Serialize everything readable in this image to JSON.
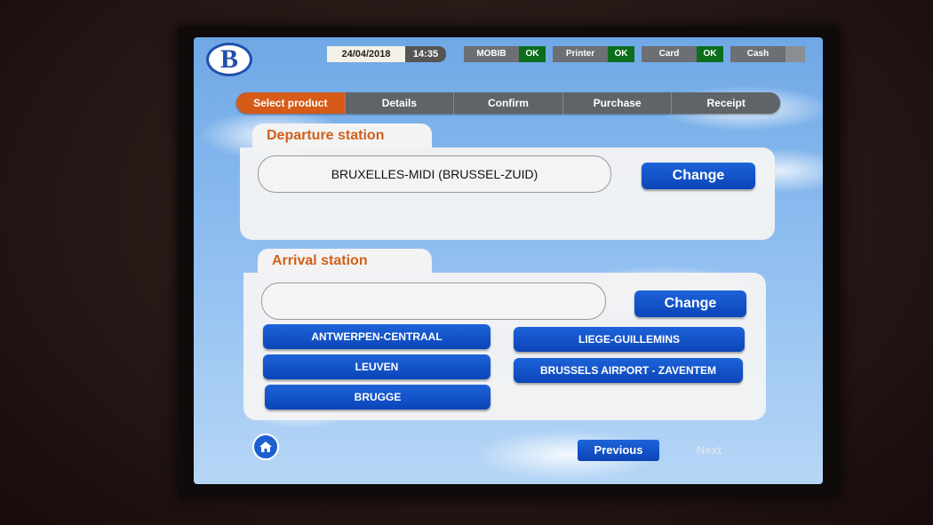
{
  "header": {
    "logo_letter": "B",
    "date": "24/04/2018",
    "time": "14:35",
    "status": [
      {
        "label": "MOBIB",
        "value": "OK"
      },
      {
        "label": "Printer",
        "value": "OK"
      },
      {
        "label": "Card",
        "value": "OK"
      },
      {
        "label": "Cash",
        "value": ""
      }
    ]
  },
  "steps": [
    "Select product",
    "Details",
    "Confirm",
    "Purchase",
    "Receipt"
  ],
  "departure": {
    "title": "Departure station",
    "value": "BRUXELLES-MIDI (BRUSSEL-ZUID)",
    "change_label": "Change"
  },
  "arrival": {
    "title": "Arrival station",
    "value": "",
    "change_label": "Change",
    "quick_stations": [
      "ANTWERPEN-CENTRAAL",
      "LIEGE-GUILLEMINS",
      "LEUVEN",
      "BRUSSELS AIRPORT - ZAVENTEM",
      "BRUGGE"
    ]
  },
  "footer": {
    "previous_label": "Previous",
    "next_label": "Next"
  },
  "colors": {
    "accent_orange": "#d65a18",
    "button_blue": "#0b45b8",
    "ok_green": "#0c6d1c"
  },
  "icons": {
    "home": "home-icon"
  }
}
